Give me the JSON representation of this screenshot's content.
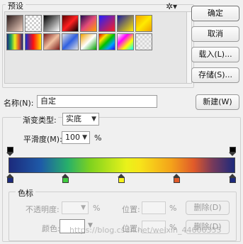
{
  "presets": {
    "title": "预设",
    "gear_icon": "gear-icon",
    "swatches": [
      "linear-gradient(135deg,#2a1a1a,#f1d1c1)",
      "repeating-conic-gradient(#cfcfcf 0 25%, #ffffff 0 50%) 0 0/6px 6px",
      "linear-gradient(135deg,#000,#fff)",
      "linear-gradient(135deg,#5a0000,#ff2020,#000)",
      "linear-gradient(135deg,#1e0a50,#e34a7a,#ffa000)",
      "linear-gradient(135deg,#2020ff,#ff2020)",
      "linear-gradient(135deg,#1a1aa0,#ffea00)",
      "linear-gradient(135deg,#f0a000,#ffea00,#f0a000)",
      "linear-gradient(90deg,#1c2a7c,#1ea060,#e9f21a,#e05a2a,#1c2a7c)",
      "linear-gradient(90deg,#1030d0,#ff1010,#ffe000)",
      "linear-gradient(135deg,#7a1a1a,#f0c0a0,#7a1a1a)",
      "linear-gradient(135deg,#e0e0e0,#3060e0,#e0e0e0)",
      "linear-gradient(135deg,#f0a000,#ffffff,#00a000)",
      "linear-gradient(135deg,#e00000,#ffe000,#00c000,#00a0ff,#3000ff)",
      "linear-gradient(135deg,#ffffff,#ff00ff,#ffff00,#00ffff)",
      "repeating-conic-gradient(#d8d8d8 0 25%, #f0f0f0 0 50%) 0 0/6px 6px"
    ]
  },
  "buttons": {
    "ok": "确定",
    "cancel": "取消",
    "load": "载入(L)...",
    "save": "存储(S)...",
    "new": "新建(W)",
    "delete_opacity": "删除(D)",
    "delete_color": "删除(D)"
  },
  "name": {
    "label": "名称(N):",
    "value": "自定"
  },
  "gradient_type": {
    "label": "渐变类型:",
    "value": "实底"
  },
  "smoothness": {
    "label": "平滑度(M):",
    "value": "100",
    "unit": "%"
  },
  "color_stops_section": {
    "title": "色标",
    "opacity_label": "不透明度:",
    "opacity_unit": "%",
    "location_label": "位置:",
    "location_unit": "%",
    "color_label": "颜色:"
  },
  "watermark": "https://blog.csdn.net/weixin_44606355",
  "stop_colors": {
    "opacity": [
      "#000000",
      "#000000"
    ],
    "color": [
      "#1c2a7c",
      "#3fcc3f",
      "#f7f21a",
      "#e05a2a",
      "#1c2a7c"
    ]
  }
}
